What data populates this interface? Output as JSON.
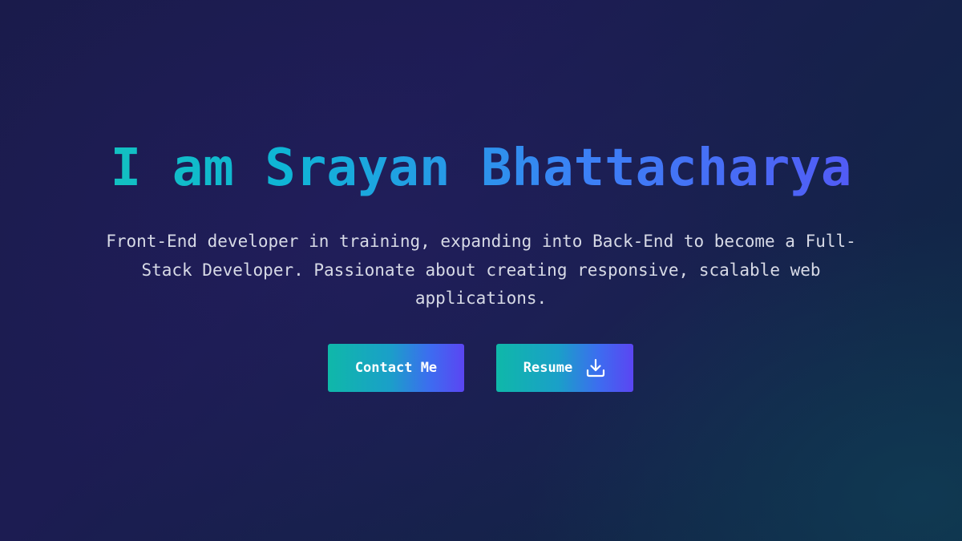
{
  "hero": {
    "title": "I am Srayan Bhattacharya",
    "description": "Front-End developer in training, expanding into Back-End to become a Full-Stack Developer. Passionate about creating responsive, scalable web applications.",
    "contact_button_label": "Contact Me",
    "resume_button_label": "Resume",
    "resume_icon": "download-icon"
  },
  "colors": {
    "gradient_start": "#14c7b4",
    "gradient_mid": "#3b82f6",
    "gradient_end": "#5b4cf5",
    "background": "#1a1b4b"
  }
}
